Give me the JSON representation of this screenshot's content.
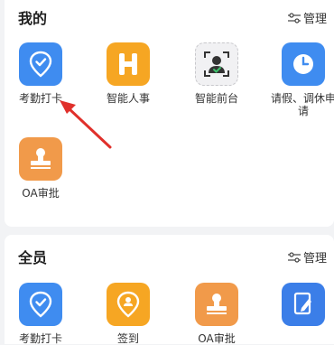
{
  "mine": {
    "title": "我的",
    "manage_label": "管理",
    "apps": [
      {
        "label": "考勤打卡",
        "icon": "location-check-icon",
        "color": "#3f8cf0"
      },
      {
        "label": "智能人事",
        "icon": "h-letter-icon",
        "color": "#f6a623"
      },
      {
        "label": "智能前台",
        "icon": "face-scan-icon",
        "color": "#f1f1f3"
      },
      {
        "label": "请假、调休申请",
        "icon": "clock-icon",
        "color": "#3f8cf0"
      },
      {
        "label": "OA审批",
        "icon": "stamp-icon",
        "color": "#f19a4a"
      }
    ]
  },
  "all": {
    "title": "全员",
    "manage_label": "管理",
    "apps": [
      {
        "label": "考勤打卡",
        "icon": "location-check-icon",
        "color": "#3f8cf0"
      },
      {
        "label": "签到",
        "icon": "location-person-icon",
        "color": "#f6a623"
      },
      {
        "label": "OA审批",
        "icon": "stamp-icon",
        "color": "#f19a4a"
      },
      {
        "label": "",
        "icon": "notebook-pen-icon",
        "color": "#3b7ee8"
      }
    ]
  },
  "annotation": {
    "arrow_color": "#e0302b"
  }
}
